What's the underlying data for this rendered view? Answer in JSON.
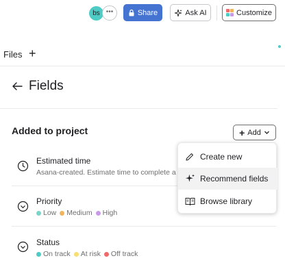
{
  "topbar": {
    "avatar_initials": "bs",
    "more_label": "•••",
    "share_label": "Share",
    "ask_ai_label": "Ask AI",
    "customize_label": "Customize"
  },
  "files": {
    "label": "Files",
    "add_symbol": "+"
  },
  "panel": {
    "title": "Fields",
    "section_title": "Added to project",
    "add_label": "Add"
  },
  "fields": [
    {
      "name": "Estimated time",
      "description": "Asana-created. Estimate time to complete a",
      "icon": "clock-icon"
    },
    {
      "name": "Priority",
      "icon": "chevron-circle-icon",
      "options": [
        {
          "label": "Low",
          "color": "#7ad4c9"
        },
        {
          "label": "Medium",
          "color": "#f0b45e"
        },
        {
          "label": "High",
          "color": "#c99ae6"
        }
      ]
    },
    {
      "name": "Status",
      "icon": "chevron-circle-icon",
      "options": [
        {
          "label": "On track",
          "color": "#4ecbc4"
        },
        {
          "label": "At risk",
          "color": "#f8df72"
        },
        {
          "label": "Off track",
          "color": "#f06a6a"
        }
      ]
    }
  ],
  "menu": {
    "items": [
      {
        "label": "Create new",
        "icon": "pencil-icon"
      },
      {
        "label": "Recommend fields",
        "icon": "sparkle-icon"
      },
      {
        "label": "Browse library",
        "icon": "book-icon"
      }
    ]
  },
  "colors": {
    "share_bg": "#4573d2",
    "avatar_bg": "#4ecbc4"
  }
}
